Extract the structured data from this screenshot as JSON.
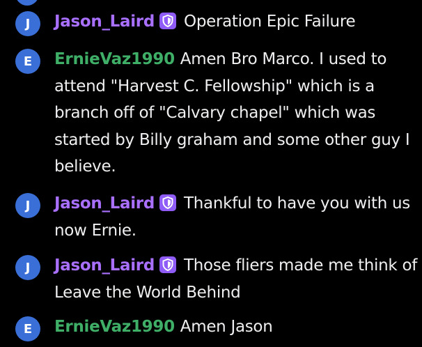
{
  "colors": {
    "background": "#000000",
    "avatar": "#3a6fd8",
    "moderator_name": "#a970ff",
    "user_name": "#3fae67",
    "badge": "#8f5cf7",
    "text": "#efeff1"
  },
  "messages": [
    {
      "avatar_letter": "J",
      "username": "Jason_Laird",
      "has_badge": true,
      "badge_icon": "shield-icon",
      "text": "Operation Epic Failure"
    },
    {
      "avatar_letter": "E",
      "username": "ErnieVaz1990",
      "has_badge": false,
      "text": "Amen Bro Marco. I used to attend \"Harvest C. Fellowship\" which is a branch off of \"Calvary chapel\" which was started by Billy graham and some other guy I believe."
    },
    {
      "avatar_letter": "J",
      "username": "Jason_Laird",
      "has_badge": true,
      "badge_icon": "shield-icon",
      "text": "Thankful to have you with us now Ernie."
    },
    {
      "avatar_letter": "J",
      "username": "Jason_Laird",
      "has_badge": true,
      "badge_icon": "shield-icon",
      "text": "Those fliers made me think of Leave the World Behind"
    },
    {
      "avatar_letter": "E",
      "username": "ErnieVaz1990",
      "has_badge": false,
      "text": "Amen Jason"
    }
  ]
}
